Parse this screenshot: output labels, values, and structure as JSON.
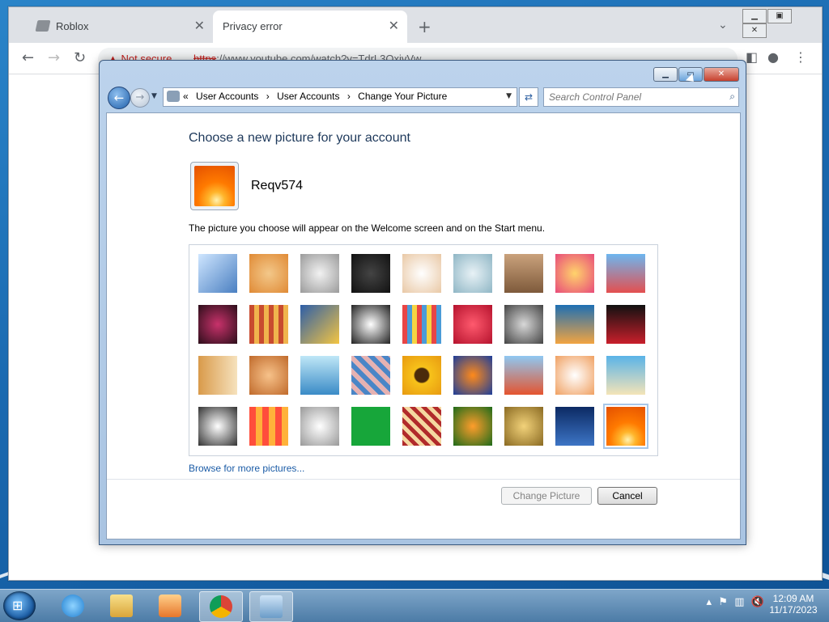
{
  "browser": {
    "tabs": [
      {
        "title": "Roblox",
        "active": false
      },
      {
        "title": "Privacy error",
        "active": true
      }
    ],
    "new_tab_label": "+",
    "omnibox": {
      "warning": "Not secure",
      "url_scheme": "https",
      "url_rest": "://www.youtube.com/watch?v=TdrL3QxjvVw"
    }
  },
  "control_panel": {
    "breadcrumbs": [
      "«",
      "User Accounts",
      "›",
      "User Accounts",
      "›",
      "Change Your Picture"
    ],
    "search_placeholder": "Search Control Panel",
    "heading": "Choose a new picture for your account",
    "username": "Reqv574",
    "description": "The picture you choose will appear on the Welcome screen and on the Start menu.",
    "pictures": [
      "roller-coaster",
      "starfish",
      "robot-toy",
      "record-player",
      "lucky-cat",
      "gyroscope",
      "kitten",
      "pink-flower",
      "ferris-wheel",
      "ball",
      "fabric",
      "yellow-leaf",
      "border-collie",
      "crayons",
      "paper-lantern",
      "jacks",
      "stairs",
      "origami-crane",
      "guitar",
      "pomeranian",
      "tin-robot",
      "textile",
      "sunflower",
      "clownfish",
      "hot-air-balloon",
      "daruma",
      "sailboat",
      "soccer-ball",
      "striped-fabric",
      "marbles",
      "green-window",
      "woven-rug",
      "butterfly",
      "nautilus",
      "lighthouse",
      "orange-flower"
    ],
    "selected_picture": "orange-flower",
    "browse_link": "Browse for more pictures...",
    "change_button": "Change Picture",
    "cancel_button": "Cancel"
  },
  "taskbar": {
    "time": "12:09 AM",
    "date": "11/17/2023",
    "tray_icons": [
      "show-hidden-icon",
      "flag-icon",
      "network-icon",
      "volume-muted-icon"
    ]
  },
  "colors": {
    "heading": "#1e395b",
    "link": "#1a5ba6",
    "close_button": "#c7402e",
    "not_secure": "#c5221f"
  }
}
